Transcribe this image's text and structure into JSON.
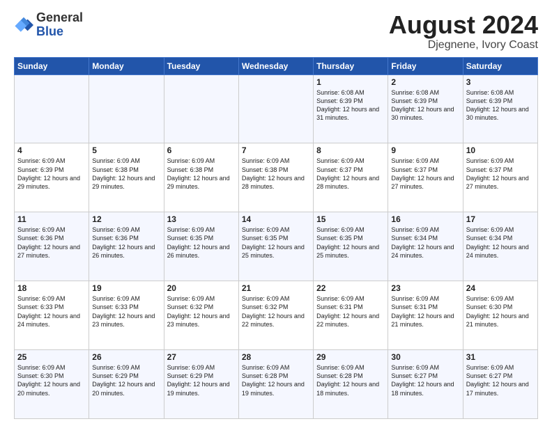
{
  "header": {
    "logo_general": "General",
    "logo_blue": "Blue",
    "main_title": "August 2024",
    "subtitle": "Djegnene, Ivory Coast"
  },
  "calendar": {
    "days_of_week": [
      "Sunday",
      "Monday",
      "Tuesday",
      "Wednesday",
      "Thursday",
      "Friday",
      "Saturday"
    ],
    "weeks": [
      [
        {
          "day": "",
          "info": ""
        },
        {
          "day": "",
          "info": ""
        },
        {
          "day": "",
          "info": ""
        },
        {
          "day": "",
          "info": ""
        },
        {
          "day": "1",
          "info": "Sunrise: 6:08 AM\nSunset: 6:39 PM\nDaylight: 12 hours\nand 31 minutes."
        },
        {
          "day": "2",
          "info": "Sunrise: 6:08 AM\nSunset: 6:39 PM\nDaylight: 12 hours\nand 30 minutes."
        },
        {
          "day": "3",
          "info": "Sunrise: 6:08 AM\nSunset: 6:39 PM\nDaylight: 12 hours\nand 30 minutes."
        }
      ],
      [
        {
          "day": "4",
          "info": "Sunrise: 6:09 AM\nSunset: 6:39 PM\nDaylight: 12 hours\nand 29 minutes."
        },
        {
          "day": "5",
          "info": "Sunrise: 6:09 AM\nSunset: 6:38 PM\nDaylight: 12 hours\nand 29 minutes."
        },
        {
          "day": "6",
          "info": "Sunrise: 6:09 AM\nSunset: 6:38 PM\nDaylight: 12 hours\nand 29 minutes."
        },
        {
          "day": "7",
          "info": "Sunrise: 6:09 AM\nSunset: 6:38 PM\nDaylight: 12 hours\nand 28 minutes."
        },
        {
          "day": "8",
          "info": "Sunrise: 6:09 AM\nSunset: 6:37 PM\nDaylight: 12 hours\nand 28 minutes."
        },
        {
          "day": "9",
          "info": "Sunrise: 6:09 AM\nSunset: 6:37 PM\nDaylight: 12 hours\nand 27 minutes."
        },
        {
          "day": "10",
          "info": "Sunrise: 6:09 AM\nSunset: 6:37 PM\nDaylight: 12 hours\nand 27 minutes."
        }
      ],
      [
        {
          "day": "11",
          "info": "Sunrise: 6:09 AM\nSunset: 6:36 PM\nDaylight: 12 hours\nand 27 minutes."
        },
        {
          "day": "12",
          "info": "Sunrise: 6:09 AM\nSunset: 6:36 PM\nDaylight: 12 hours\nand 26 minutes."
        },
        {
          "day": "13",
          "info": "Sunrise: 6:09 AM\nSunset: 6:35 PM\nDaylight: 12 hours\nand 26 minutes."
        },
        {
          "day": "14",
          "info": "Sunrise: 6:09 AM\nSunset: 6:35 PM\nDaylight: 12 hours\nand 25 minutes."
        },
        {
          "day": "15",
          "info": "Sunrise: 6:09 AM\nSunset: 6:35 PM\nDaylight: 12 hours\nand 25 minutes."
        },
        {
          "day": "16",
          "info": "Sunrise: 6:09 AM\nSunset: 6:34 PM\nDaylight: 12 hours\nand 24 minutes."
        },
        {
          "day": "17",
          "info": "Sunrise: 6:09 AM\nSunset: 6:34 PM\nDaylight: 12 hours\nand 24 minutes."
        }
      ],
      [
        {
          "day": "18",
          "info": "Sunrise: 6:09 AM\nSunset: 6:33 PM\nDaylight: 12 hours\nand 24 minutes."
        },
        {
          "day": "19",
          "info": "Sunrise: 6:09 AM\nSunset: 6:33 PM\nDaylight: 12 hours\nand 23 minutes."
        },
        {
          "day": "20",
          "info": "Sunrise: 6:09 AM\nSunset: 6:32 PM\nDaylight: 12 hours\nand 23 minutes."
        },
        {
          "day": "21",
          "info": "Sunrise: 6:09 AM\nSunset: 6:32 PM\nDaylight: 12 hours\nand 22 minutes."
        },
        {
          "day": "22",
          "info": "Sunrise: 6:09 AM\nSunset: 6:31 PM\nDaylight: 12 hours\nand 22 minutes."
        },
        {
          "day": "23",
          "info": "Sunrise: 6:09 AM\nSunset: 6:31 PM\nDaylight: 12 hours\nand 21 minutes."
        },
        {
          "day": "24",
          "info": "Sunrise: 6:09 AM\nSunset: 6:30 PM\nDaylight: 12 hours\nand 21 minutes."
        }
      ],
      [
        {
          "day": "25",
          "info": "Sunrise: 6:09 AM\nSunset: 6:30 PM\nDaylight: 12 hours\nand 20 minutes."
        },
        {
          "day": "26",
          "info": "Sunrise: 6:09 AM\nSunset: 6:29 PM\nDaylight: 12 hours\nand 20 minutes."
        },
        {
          "day": "27",
          "info": "Sunrise: 6:09 AM\nSunset: 6:29 PM\nDaylight: 12 hours\nand 19 minutes."
        },
        {
          "day": "28",
          "info": "Sunrise: 6:09 AM\nSunset: 6:28 PM\nDaylight: 12 hours\nand 19 minutes."
        },
        {
          "day": "29",
          "info": "Sunrise: 6:09 AM\nSunset: 6:28 PM\nDaylight: 12 hours\nand 18 minutes."
        },
        {
          "day": "30",
          "info": "Sunrise: 6:09 AM\nSunset: 6:27 PM\nDaylight: 12 hours\nand 18 minutes."
        },
        {
          "day": "31",
          "info": "Sunrise: 6:09 AM\nSunset: 6:27 PM\nDaylight: 12 hours\nand 17 minutes."
        }
      ]
    ]
  }
}
